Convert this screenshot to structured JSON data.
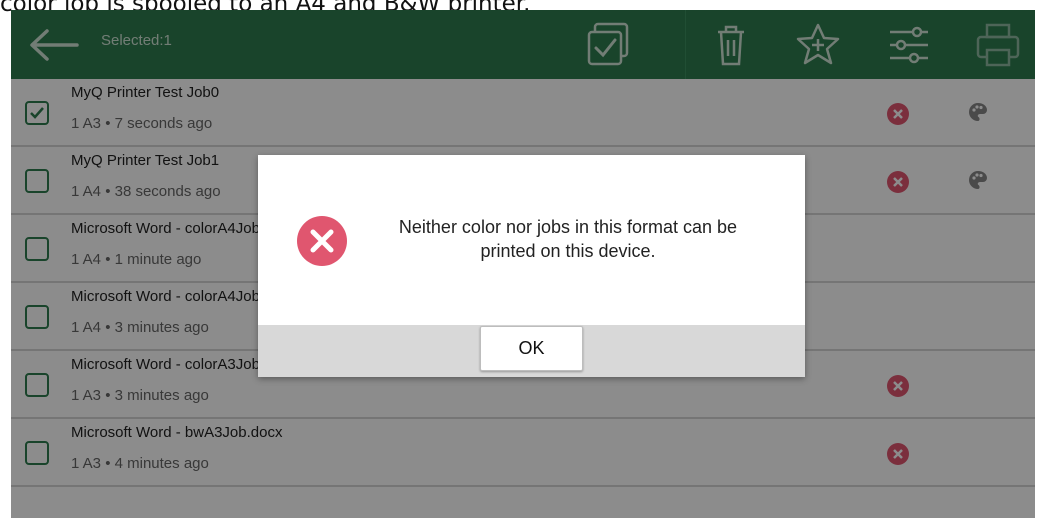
{
  "caption": "color job is spooled to an A4 and B&W printer.",
  "topbar": {
    "selected_label": "Selected:1"
  },
  "jobs": [
    {
      "title": "MyQ Printer Test Job0",
      "meta": "1 A3 • 7 seconds ago",
      "checked": true,
      "has_error": true,
      "has_color": true
    },
    {
      "title": "MyQ Printer Test Job1",
      "meta": "1 A4 • 38 seconds ago",
      "checked": false,
      "has_error": true,
      "has_color": true
    },
    {
      "title": "Microsoft Word - colorA4Job.docx",
      "meta": "1 A4 • 1 minute ago",
      "checked": false,
      "has_error": false,
      "has_color": false
    },
    {
      "title": "Microsoft Word - colorA4Job.docx",
      "meta": "1 A4 • 3 minutes ago",
      "checked": false,
      "has_error": false,
      "has_color": false
    },
    {
      "title": "Microsoft Word - colorA3Job.docx",
      "meta": "1 A3 • 3 minutes ago",
      "checked": false,
      "has_error": true,
      "has_color": false
    },
    {
      "title": "Microsoft Word - bwA3Job.docx",
      "meta": "1 A3 • 4 minutes ago",
      "checked": false,
      "has_error": true,
      "has_color": false
    }
  ],
  "dialog": {
    "message_line1": "Neither color nor jobs in this format can be",
    "message_line2": "printed on this device.",
    "ok_label": "OK"
  },
  "colors": {
    "topbar": "#2e7d4f",
    "error": "#e0566f"
  }
}
